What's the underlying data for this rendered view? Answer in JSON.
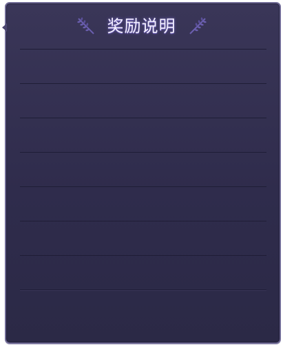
{
  "dialog": {
    "title": "奖励说明",
    "rows": [
      "",
      "",
      "",
      "",
      "",
      "",
      "",
      ""
    ],
    "colors": {
      "panel": "#2f2c4c",
      "border": "#6f6a95",
      "title_glow": "#7c6dc7",
      "laurel": "#6b5fb0"
    },
    "icons": {
      "left": "laurel-left-icon",
      "right": "laurel-right-icon"
    }
  }
}
